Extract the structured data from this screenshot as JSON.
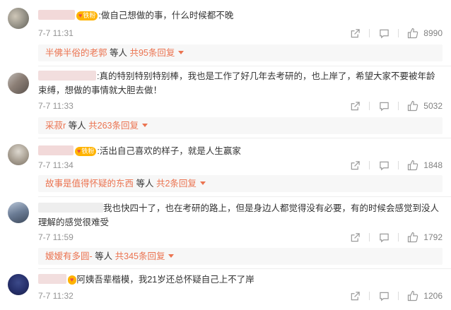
{
  "comments": [
    {
      "text": "做自己想做的事，什么时候都不晚",
      "text2": "",
      "badge": "铁粉",
      "time": "7-7 11:31",
      "likes": "8990",
      "reply_user": "半佛半俗的老郭",
      "reply_suffix": " 等人 ",
      "reply_count": "共95条回复"
    },
    {
      "text": "真的特别特别特别棒，我也是工作了好几年去考研的，也上岸了，希望大家不要被年龄",
      "text2": "束缚，想做的事情就大胆去做！",
      "badge": "",
      "time": "7-7 11:33",
      "likes": "5032",
      "reply_user": "采菽r",
      "reply_suffix": " 等人 ",
      "reply_count": "共263条回复"
    },
    {
      "text": "活出自己喜欢的样子，就是人生赢家",
      "text2": "",
      "badge": "铁粉",
      "time": "7-7 11:34",
      "likes": "1848",
      "reply_user": "故事是值得怀疑的东西",
      "reply_suffix": " 等人 ",
      "reply_count": "共2条回复"
    },
    {
      "text": "我也快四十了，也在考研的路上，但是身边人都觉得没有必要，有的时候会感觉到没人",
      "text2": "理解的感觉很难受",
      "badge": "",
      "time": "7-7 11:59",
      "likes": "1792",
      "reply_user": "嫒嫒有多圆-",
      "reply_suffix": " 等人 ",
      "reply_count": "共345条回复"
    },
    {
      "text": "阿姨吾辈楷模，我21岁还总怀疑自己上不了岸",
      "text2": "",
      "badge": "",
      "time": "7-7 11:32",
      "likes": "1206"
    }
  ],
  "icons": {
    "share": "share-icon",
    "comment": "comment-icon",
    "like": "thumbs-up-icon",
    "expand": "caret-down-icon"
  },
  "colors": {
    "accent": "#eb7350",
    "meta": "#939393",
    "badge": "#ffb300"
  }
}
